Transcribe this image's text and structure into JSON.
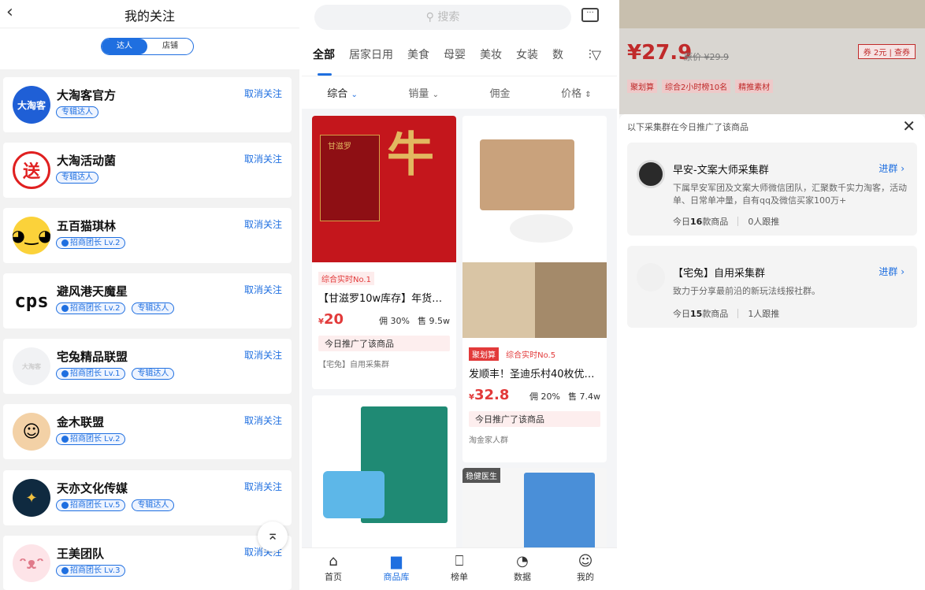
{
  "follow": {
    "title": "我的关注",
    "seg_on": "达人",
    "seg_off": "店铺",
    "unfollow_label": "取消关注",
    "items": [
      {
        "name": "大淘客官方",
        "avatar_text": "大淘客",
        "tags": [
          "专辑达人"
        ]
      },
      {
        "name": "大淘活动菌",
        "avatar_text": "送",
        "tags": [
          "专辑达人"
        ]
      },
      {
        "name": "五百猫琪林",
        "avatar_text": "",
        "tags": [
          "招商团长 Lv.2"
        ]
      },
      {
        "name": "避风港天魔星",
        "avatar_text": "cps",
        "tags": [
          "招商团长 Lv.2",
          "专辑达人"
        ]
      },
      {
        "name": "宅兔精品联盟",
        "avatar_text": "大淘客",
        "tags": [
          "招商团长 Lv.1",
          "专辑达人"
        ]
      },
      {
        "name": "金木联盟",
        "avatar_text": "",
        "tags": [
          "招商团长 Lv.2"
        ]
      },
      {
        "name": "天亦文化传媒",
        "avatar_text": "",
        "tags": [
          "招商团长 Lv.5",
          "专辑达人"
        ]
      },
      {
        "name": "王美团队",
        "avatar_text": "",
        "tags": [
          "招商团长 Lv.3"
        ]
      }
    ]
  },
  "library": {
    "search_placeholder": "搜索",
    "categories": [
      "全部",
      "居家日用",
      "美食",
      "母婴",
      "美妆",
      "女装",
      "数"
    ],
    "sorts": [
      "综合",
      "销量",
      "佣金",
      "价格"
    ],
    "cards": [
      {
        "tag": "综合实时No.1",
        "title": "【甘滋罗10w库存】年货…",
        "price": "20",
        "commission": "佣 30%",
        "sold": "售 9.5w",
        "promo": "今日推广了该商品",
        "group": "【宅兔】自用采集群",
        "img_text": "甘滋罗"
      },
      {
        "tag1": "聚划算",
        "tag": "综合实时No.5",
        "title": "发顺丰！圣迪乐村40枚优…",
        "price": "32.8",
        "commission": "佣 20%",
        "sold": "售 7.4w",
        "promo": "今日推广了该商品",
        "group": "淘金家人群"
      },
      {
        "badge": "稳健医生"
      }
    ],
    "tabs": [
      "首页",
      "商品库",
      "榜单",
      "数据",
      "我的"
    ]
  },
  "detail": {
    "price": "¥27.9",
    "orig_price": "原价 ¥29.9",
    "coupon": "券 2元 | 查券",
    "tags": [
      "聚划算",
      "综合2小时榜10名",
      "精推素材"
    ],
    "sheet_title": "以下采集群在今日推广了该商品",
    "groups": [
      {
        "name": "早安-文案大师采集群",
        "join": "进群 ›",
        "desc": "下属早安军团及文案大师微信团队，汇聚数千实力淘客，活动单、日常单冲量，自有qq及微信买家100万+",
        "today_label": "今日",
        "today_count": "16",
        "today_unit": "款商品",
        "followers": "0人跟推"
      },
      {
        "name": "【宅兔】自用采集群",
        "join": "进群 ›",
        "desc": "致力于分享最前沿的新玩法线报社群。",
        "today_label": "今日",
        "today_count": "15",
        "today_unit": "款商品",
        "followers": "1人跟推"
      }
    ]
  }
}
